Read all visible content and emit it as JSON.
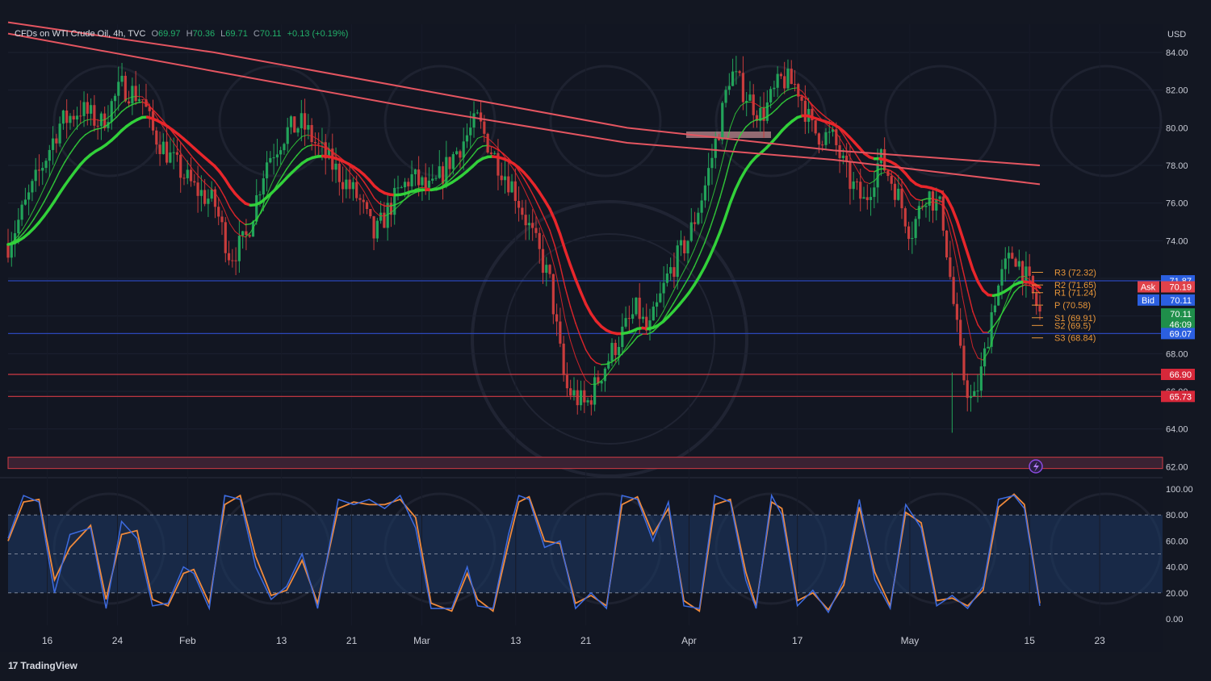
{
  "header": {
    "symbol": "CFDs on WTI Crude Oil, 4h, TVC",
    "open_label": "O",
    "open": "69.97",
    "high_label": "H",
    "high": "70.36",
    "low_label": "L",
    "low": "69.71",
    "close_label": "C",
    "close": "70.11",
    "change": "+0.13 (+0.19%)"
  },
  "footer": {
    "brand": "TradingView"
  },
  "colors": {
    "background": "#121622",
    "grid": "#1c2130",
    "bull": "#22a35a",
    "bear": "#c83c3c",
    "ema_red": "#e8262b",
    "ema_green": "#32d13a",
    "sma_long": "#e45560",
    "stoch_k": "#3d6be0",
    "stoch_d": "#f08a3c",
    "pivot": "#e8963a",
    "line_blue": "#2b47b8",
    "line_red": "#d23a44"
  },
  "chart_data": [
    {
      "type": "line",
      "title": "CFDs on WTI Crude Oil, 4h, TVC",
      "currency": "USD",
      "ylim": [
        61.5,
        85.5
      ],
      "y_ticks": [
        "84.00",
        "82.00",
        "80.00",
        "78.00",
        "76.00",
        "74.00",
        "72.00",
        "70.00",
        "68.00",
        "66.00",
        "64.00",
        "62.00"
      ],
      "x_tick_labels": [
        "16",
        "24",
        "Feb",
        "13",
        "21",
        "Mar",
        "13",
        "21",
        "Apr",
        "17",
        "May",
        "15",
        "23"
      ],
      "price_close_path": [
        [
          0,
          73.8
        ],
        [
          0.02,
          76.3
        ],
        [
          0.05,
          80.2
        ],
        [
          0.07,
          81.0
        ],
        [
          0.09,
          80.2
        ],
        [
          0.11,
          82.2
        ],
        [
          0.13,
          81.6
        ],
        [
          0.14,
          79.8
        ],
        [
          0.16,
          78.2
        ],
        [
          0.18,
          76.8
        ],
        [
          0.2,
          76.0
        ],
        [
          0.215,
          73.2
        ],
        [
          0.23,
          74.0
        ],
        [
          0.25,
          78.2
        ],
        [
          0.27,
          79.8
        ],
        [
          0.285,
          80.2
        ],
        [
          0.3,
          79.0
        ],
        [
          0.32,
          77.6
        ],
        [
          0.34,
          76.2
        ],
        [
          0.355,
          74.2
        ],
        [
          0.37,
          75.8
        ],
        [
          0.39,
          77.4
        ],
        [
          0.41,
          76.6
        ],
        [
          0.43,
          78.4
        ],
        [
          0.455,
          80.4
        ],
        [
          0.47,
          78.6
        ],
        [
          0.49,
          76.8
        ],
        [
          0.51,
          74.0
        ],
        [
          0.525,
          71.8
        ],
        [
          0.54,
          66.2
        ],
        [
          0.56,
          65.2
        ],
        [
          0.575,
          67.0
        ],
        [
          0.59,
          68.6
        ],
        [
          0.61,
          70.4
        ],
        [
          0.62,
          69.0
        ],
        [
          0.64,
          72.2
        ],
        [
          0.66,
          74.2
        ],
        [
          0.675,
          76.8
        ],
        [
          0.69,
          80.2
        ],
        [
          0.7,
          83.0
        ],
        [
          0.715,
          81.8
        ],
        [
          0.73,
          80.6
        ],
        [
          0.75,
          82.6
        ],
        [
          0.765,
          82.2
        ],
        [
          0.78,
          79.8
        ],
        [
          0.8,
          79.4
        ],
        [
          0.815,
          77.2
        ],
        [
          0.83,
          76.0
        ],
        [
          0.845,
          78.4
        ],
        [
          0.86,
          76.8
        ],
        [
          0.875,
          74.4
        ],
        [
          0.89,
          76.6
        ],
        [
          0.905,
          75.6
        ],
        [
          0.915,
          71.2
        ],
        [
          0.925,
          67.0
        ],
        [
          0.935,
          65.2
        ],
        [
          0.945,
          67.4
        ],
        [
          0.955,
          70.8
        ],
        [
          0.965,
          72.4
        ],
        [
          0.975,
          73.4
        ],
        [
          0.985,
          72.2
        ],
        [
          1.0,
          70.11
        ]
      ],
      "series": [
        {
          "name": "",
          "kind": "sma_long_1",
          "x": [
            0,
            0.2,
            0.4,
            0.6,
            0.8,
            1.0
          ],
          "values": [
            85.6,
            84.0,
            82.0,
            80.0,
            78.8,
            78.0
          ]
        },
        {
          "name": "",
          "kind": "sma_long_2",
          "x": [
            0,
            0.2,
            0.4,
            0.6,
            0.8,
            1.0
          ],
          "values": [
            85.0,
            83.0,
            81.0,
            79.2,
            78.3,
            77.0
          ]
        }
      ],
      "horizontal_levels": [
        {
          "value": 71.87,
          "label": "71.87",
          "color": "#2b47b8"
        },
        {
          "value": 69.07,
          "label": "69.07",
          "color": "#2b47b8"
        },
        {
          "value": 66.9,
          "label": "66.90",
          "color": "#d23a44"
        },
        {
          "value": 65.73,
          "label": "65.73",
          "color": "#d23a44"
        }
      ],
      "pivots": [
        {
          "label": "R3 (72.32)",
          "value": 72.32
        },
        {
          "label": "R2 (71.65)",
          "value": 71.65
        },
        {
          "label": "R1 (71.24)",
          "value": 71.24
        },
        {
          "label": "P (70.58)",
          "value": 70.58
        },
        {
          "label": "S1 (69.91)",
          "value": 69.91
        },
        {
          "label": "S2 (69.5)",
          "value": 69.5
        },
        {
          "label": "S3 (68.84)",
          "value": 68.84
        }
      ],
      "price_tags": [
        {
          "label": "",
          "text": "71.87",
          "value": 71.87,
          "bg": "#2b5fe0"
        },
        {
          "label": "Ask",
          "text": "70.19",
          "value": 71.55,
          "bg": "#e0424a"
        },
        {
          "label": "Bid",
          "text": "70.11",
          "value": 70.85,
          "bg": "#2b5fe0"
        },
        {
          "label": "",
          "text": "70.11",
          "value": 70.11,
          "bg": "#1f8f4a"
        },
        {
          "label": "",
          "text": "46:09",
          "value": 69.55,
          "bg": "#1f8f4a"
        },
        {
          "label": "",
          "text": "69.07",
          "value": 69.07,
          "bg": "#2b5fe0"
        },
        {
          "label": "",
          "text": "66.90",
          "value": 66.9,
          "bg": "#d7283a"
        },
        {
          "label": "",
          "text": "65.73",
          "value": 65.73,
          "bg": "#d7283a"
        }
      ]
    },
    {
      "type": "line",
      "title": "",
      "ylim": [
        -5,
        105
      ],
      "y_ticks": [
        "100.00",
        "80.00",
        "60.00",
        "40.00",
        "20.00",
        "0.00"
      ],
      "band": [
        20,
        80
      ],
      "series": [
        {
          "name": "",
          "kind": "stoch_k"
        },
        {
          "name": "",
          "kind": "stoch_d"
        }
      ],
      "k_path": [
        [
          0,
          62
        ],
        [
          0.015,
          95
        ],
        [
          0.03,
          90
        ],
        [
          0.045,
          20
        ],
        [
          0.06,
          65
        ],
        [
          0.08,
          70
        ],
        [
          0.095,
          8
        ],
        [
          0.11,
          75
        ],
        [
          0.125,
          62
        ],
        [
          0.14,
          10
        ],
        [
          0.155,
          12
        ],
        [
          0.17,
          40
        ],
        [
          0.18,
          35
        ],
        [
          0.195,
          8
        ],
        [
          0.21,
          95
        ],
        [
          0.225,
          92
        ],
        [
          0.24,
          40
        ],
        [
          0.255,
          15
        ],
        [
          0.27,
          25
        ],
        [
          0.285,
          50
        ],
        [
          0.3,
          8
        ],
        [
          0.32,
          92
        ],
        [
          0.335,
          88
        ],
        [
          0.35,
          92
        ],
        [
          0.365,
          85
        ],
        [
          0.38,
          95
        ],
        [
          0.395,
          70
        ],
        [
          0.41,
          8
        ],
        [
          0.43,
          8
        ],
        [
          0.445,
          40
        ],
        [
          0.455,
          10
        ],
        [
          0.47,
          8
        ],
        [
          0.485,
          65
        ],
        [
          0.495,
          95
        ],
        [
          0.505,
          92
        ],
        [
          0.52,
          55
        ],
        [
          0.535,
          60
        ],
        [
          0.55,
          8
        ],
        [
          0.565,
          20
        ],
        [
          0.58,
          8
        ],
        [
          0.595,
          95
        ],
        [
          0.61,
          92
        ],
        [
          0.625,
          60
        ],
        [
          0.64,
          90
        ],
        [
          0.655,
          10
        ],
        [
          0.67,
          8
        ],
        [
          0.685,
          95
        ],
        [
          0.7,
          90
        ],
        [
          0.715,
          30
        ],
        [
          0.725,
          8
        ],
        [
          0.74,
          95
        ],
        [
          0.75,
          80
        ],
        [
          0.765,
          10
        ],
        [
          0.78,
          22
        ],
        [
          0.795,
          5
        ],
        [
          0.81,
          30
        ],
        [
          0.825,
          92
        ],
        [
          0.84,
          30
        ],
        [
          0.855,
          8
        ],
        [
          0.87,
          88
        ],
        [
          0.885,
          70
        ],
        [
          0.9,
          10
        ],
        [
          0.915,
          18
        ],
        [
          0.93,
          8
        ],
        [
          0.945,
          25
        ],
        [
          0.96,
          92
        ],
        [
          0.975,
          95
        ],
        [
          0.985,
          85
        ],
        [
          1.0,
          10
        ]
      ],
      "d_path": [
        [
          0,
          60
        ],
        [
          0.015,
          90
        ],
        [
          0.03,
          92
        ],
        [
          0.045,
          30
        ],
        [
          0.06,
          55
        ],
        [
          0.08,
          72
        ],
        [
          0.095,
          15
        ],
        [
          0.11,
          65
        ],
        [
          0.125,
          68
        ],
        [
          0.14,
          15
        ],
        [
          0.155,
          10
        ],
        [
          0.17,
          35
        ],
        [
          0.18,
          38
        ],
        [
          0.195,
          12
        ],
        [
          0.21,
          88
        ],
        [
          0.225,
          95
        ],
        [
          0.24,
          48
        ],
        [
          0.255,
          18
        ],
        [
          0.27,
          22
        ],
        [
          0.285,
          45
        ],
        [
          0.3,
          12
        ],
        [
          0.32,
          85
        ],
        [
          0.335,
          90
        ],
        [
          0.35,
          88
        ],
        [
          0.365,
          88
        ],
        [
          0.38,
          92
        ],
        [
          0.395,
          78
        ],
        [
          0.41,
          12
        ],
        [
          0.43,
          6
        ],
        [
          0.445,
          35
        ],
        [
          0.455,
          15
        ],
        [
          0.47,
          6
        ],
        [
          0.485,
          58
        ],
        [
          0.495,
          90
        ],
        [
          0.505,
          94
        ],
        [
          0.52,
          60
        ],
        [
          0.535,
          58
        ],
        [
          0.55,
          12
        ],
        [
          0.565,
          18
        ],
        [
          0.58,
          10
        ],
        [
          0.595,
          88
        ],
        [
          0.61,
          94
        ],
        [
          0.625,
          65
        ],
        [
          0.64,
          85
        ],
        [
          0.655,
          14
        ],
        [
          0.67,
          6
        ],
        [
          0.685,
          88
        ],
        [
          0.7,
          92
        ],
        [
          0.715,
          36
        ],
        [
          0.725,
          10
        ],
        [
          0.74,
          90
        ],
        [
          0.75,
          85
        ],
        [
          0.765,
          14
        ],
        [
          0.78,
          20
        ],
        [
          0.795,
          7
        ],
        [
          0.81,
          26
        ],
        [
          0.825,
          86
        ],
        [
          0.84,
          36
        ],
        [
          0.855,
          10
        ],
        [
          0.87,
          82
        ],
        [
          0.885,
          74
        ],
        [
          0.9,
          14
        ],
        [
          0.915,
          16
        ],
        [
          0.93,
          10
        ],
        [
          0.945,
          22
        ],
        [
          0.96,
          86
        ],
        [
          0.975,
          96
        ],
        [
          0.985,
          88
        ],
        [
          1.0,
          12
        ]
      ]
    }
  ]
}
